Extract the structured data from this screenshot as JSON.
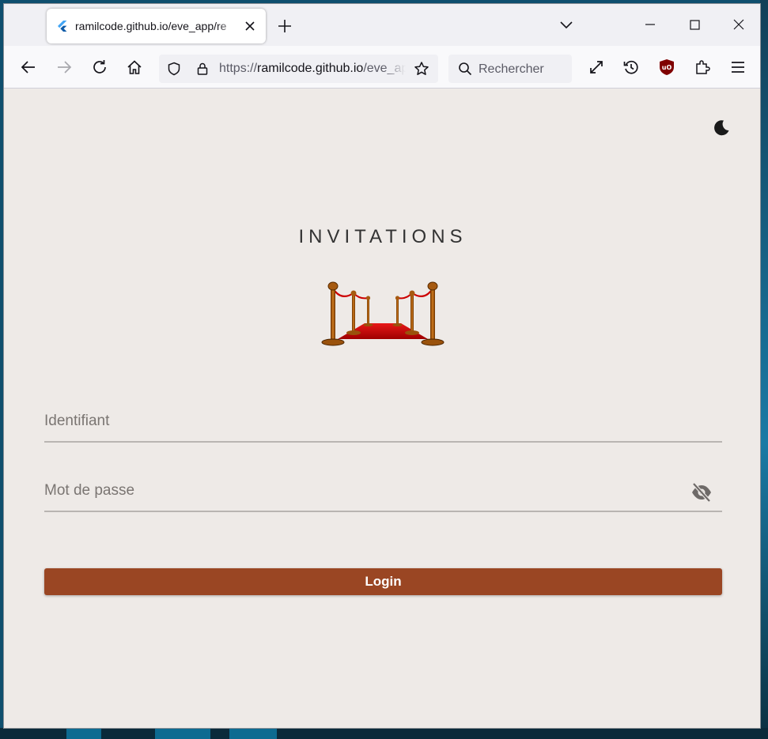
{
  "browser": {
    "tab_title": "ramilcode.github.io/eve_app/re",
    "url_scheme": "https://",
    "url_host": "ramilcode.github.io",
    "url_path": "/eve_app/",
    "search_placeholder": "Rechercher"
  },
  "app": {
    "title": "INVITATIONS",
    "logo_icon": "red-carpet-stanchions",
    "theme_toggle_icon": "moon-icon",
    "login_form": {
      "username_placeholder": "Identifiant",
      "password_placeholder": "Mot de passe",
      "password_toggle_icon": "eye-off-icon",
      "submit_label": "Login"
    }
  },
  "colors": {
    "background": "#eeeae7",
    "button": "#9a4623",
    "title_text": "#333333"
  }
}
